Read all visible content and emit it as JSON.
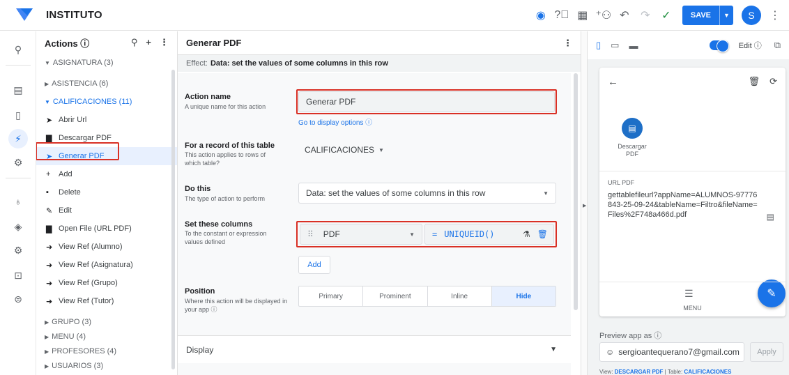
{
  "app": {
    "title": "INSTITUTO",
    "save_label": "SAVE",
    "avatar_initial": "S"
  },
  "actions_panel": {
    "title": "Actions ⓘ",
    "groups_top": [
      {
        "label": "ASIGNATURA (3)",
        "open": true
      },
      {
        "label": "ASISTENCIA (6)",
        "open": false
      },
      {
        "label": "CALIFICACIONES (11)",
        "open": true
      }
    ],
    "items": [
      {
        "icon": "send-icon",
        "glyph": "➤",
        "label": "Abrir Url"
      },
      {
        "icon": "file-icon",
        "glyph": "▇",
        "label": "Descargar PDF"
      },
      {
        "icon": "send-icon",
        "glyph": "➤",
        "label": "Generar PDF",
        "selected": true
      },
      {
        "icon": "plus-icon",
        "glyph": "+",
        "label": "Add"
      },
      {
        "icon": "trash-icon",
        "glyph": "▪",
        "label": "Delete"
      },
      {
        "icon": "edit-icon",
        "glyph": "✎",
        "label": "Edit"
      },
      {
        "icon": "file-icon",
        "glyph": "▇",
        "label": "Open File (URL PDF)"
      },
      {
        "icon": "arrow-circle-icon",
        "glyph": "➜",
        "label": "View Ref (Alumno)"
      },
      {
        "icon": "arrow-circle-icon",
        "glyph": "➜",
        "label": "View Ref (Asignatura)"
      },
      {
        "icon": "arrow-circle-icon",
        "glyph": "➜",
        "label": "View Ref (Grupo)"
      },
      {
        "icon": "arrow-circle-icon",
        "glyph": "➜",
        "label": "View Ref (Tutor)"
      }
    ],
    "groups_bottom": [
      {
        "label": "GRUPO (3)"
      },
      {
        "label": "MENU (4)"
      },
      {
        "label": "PROFESORES (4)"
      },
      {
        "label": "USUARIOS (3)"
      }
    ]
  },
  "editor": {
    "title": "Generar PDF",
    "effect_prefix": "Effect:",
    "effect_value": "Data: set the values of some columns in this row",
    "action_name": {
      "label": "Action name",
      "help": "A unique name for this action",
      "value": "Generar PDF",
      "link": "Go to display options ⓘ"
    },
    "table": {
      "label": "For a record of this table",
      "help": "This action applies to rows of which table?",
      "value": "CALIFICACIONES"
    },
    "do_this": {
      "label": "Do this",
      "help": "The type of action to perform",
      "value": "Data: set the values of some columns in this row"
    },
    "set_columns": {
      "label": "Set these columns",
      "help": "To the constant or expression values defined",
      "column": "PDF",
      "equals": "=",
      "expression": "UNIQUEID()",
      "add_label": "Add"
    },
    "position": {
      "label": "Position",
      "help": "Where this action will be displayed in your app ⓘ",
      "options": [
        "Primary",
        "Prominent",
        "Inline",
        "Hide"
      ],
      "selected": "Hide"
    },
    "display_label": "Display"
  },
  "preview": {
    "edit_label": "Edit ⓘ",
    "doc_label": "Descargar PDF",
    "url_label": "URL PDF",
    "url_value": "gettablefileurl?appName=ALUMNOS-97776843-25-09-24&tableName=Filtro&fileName=Files%2F748a466d.pdf",
    "nav_label": "MENU",
    "preview_as": "Preview app as ⓘ",
    "email": "sergioantequerano7@gmail.com",
    "apply_label": "Apply",
    "footer_view_prefix": "View:",
    "footer_view": "DESCARGAR PDF",
    "footer_table_prefix": "| Table:",
    "footer_table": "CALIFICACIONES"
  }
}
